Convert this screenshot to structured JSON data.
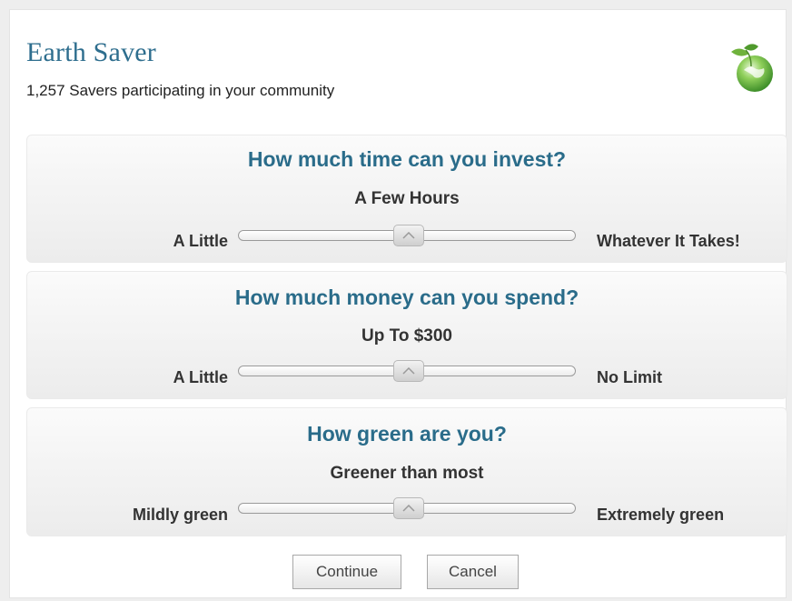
{
  "header": {
    "title": "Earth Saver",
    "subtitle": "1,257 Savers participating in your community",
    "logo_icon": "globe-leaf-icon"
  },
  "questions": [
    {
      "question": "How much time can you invest?",
      "value": "A Few Hours",
      "min_label": "A Little",
      "max_label": "Whatever It Takes!",
      "level": 0.5
    },
    {
      "question": "How much money can you spend?",
      "value": "Up To $300",
      "min_label": "A Little",
      "max_label": "No Limit",
      "level": 0.5
    },
    {
      "question": "How green are you?",
      "value": "Greener than most",
      "min_label": "Mildly green",
      "max_label": "Extremely green",
      "level": 0.5
    }
  ],
  "buttons": {
    "continue": "Continue",
    "cancel": "Cancel"
  },
  "colors": {
    "accent": "#2a6c8a",
    "title": "#2e6e8e"
  }
}
